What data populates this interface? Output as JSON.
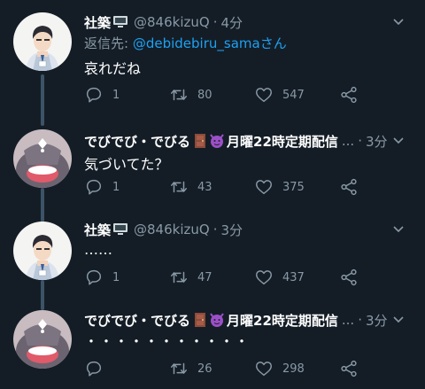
{
  "tweets": [
    {
      "name": "社築",
      "handle": "@846kizuQ",
      "dot": "·",
      "time": "4分",
      "reply_prefix": "返信先: ",
      "reply_mention": "@debidebiru_samaさん",
      "text": "哀れだね",
      "replies": "1",
      "retweets": "80",
      "likes": "547"
    },
    {
      "name": "でびでび・でびる",
      "name_suffix": "月曜22時定期配信",
      "ellipsis": "...",
      "dot": "·",
      "time": "3分",
      "text": "気づいてた？",
      "replies": "1",
      "retweets": "43",
      "likes": "375"
    },
    {
      "name": "社築",
      "handle": "@846kizuQ",
      "dot": "·",
      "time": "3分",
      "text": "……",
      "replies": "1",
      "retweets": "47",
      "likes": "437"
    },
    {
      "name": "でびでび・でびる",
      "name_suffix": "月曜22時定期配信",
      "ellipsis": "...",
      "dot": "·",
      "time": "3分",
      "text": "・・・・・・・・・・・",
      "replies": "",
      "retweets": "26",
      "likes": "298"
    }
  ],
  "colors": {
    "background": "#141d26",
    "muted": "#8899a6",
    "link": "#1da1f2",
    "thread_line": "#3d5466"
  },
  "icons": [
    "computer-emoji-icon",
    "door-emoji-icon",
    "devil-emoji-icon",
    "reply-icon",
    "retweet-icon",
    "like-icon",
    "share-icon",
    "chevron-down-icon"
  ]
}
